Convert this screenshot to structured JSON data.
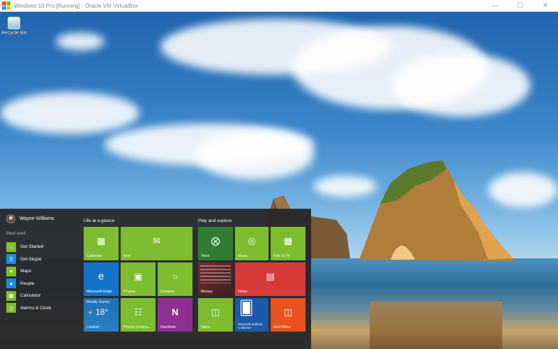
{
  "window": {
    "title": "Windows 10 Pro [Running] - Oracle VM VirtualBox",
    "icon": "virtualbox-icon",
    "controls": [
      "minimize-icon",
      "maximize-icon",
      "close-icon"
    ]
  },
  "desktop": {
    "icons": [
      {
        "label": "Recycle Bin",
        "icon": "recycle-bin-icon"
      }
    ]
  },
  "start_menu": {
    "user_name": "Wayne Williams",
    "most_used_header": "Most used",
    "apps": [
      {
        "label": "Get Started",
        "icon": "lightbulb-icon",
        "color": "#7dbd2f"
      },
      {
        "label": "Get Skype",
        "icon": "skype-icon",
        "color": "#1d8ae0"
      },
      {
        "label": "Maps",
        "icon": "person-icon",
        "color": "#7dbd2f"
      },
      {
        "label": "People",
        "icon": "people-icon",
        "color": "#1d8ae0"
      },
      {
        "label": "Calculator",
        "icon": "calculator-icon",
        "color": "#7dbd2f"
      },
      {
        "label": "Alarms & Clock",
        "icon": "alarm-icon",
        "color": "#7dbd2f"
      }
    ],
    "groups": {
      "life": "Life at a glance",
      "play": "Play and explore"
    },
    "tiles": {
      "calendar": "Calendar",
      "mail": "Mail",
      "edge": "Microsoft Edge",
      "photos": "Photos",
      "cortana": "Cortana",
      "weather_title": "Mostly Sunny",
      "weather_temp": "18°",
      "weather_city": "London",
      "phone": "Phone Compa...",
      "onenote": "OneNote",
      "xbox": "Xbox",
      "music": "Music",
      "films": "Film & TV",
      "money": "Money",
      "news": "News",
      "store": "Store",
      "solitaire": "Microsoft Solitaire Collection",
      "office": "Get Office"
    },
    "colors": {
      "green": "#7dbd2f",
      "blue": "#1473c9",
      "purple": "#8d2f93",
      "red": "#d83a3a",
      "orange": "#e9521d"
    }
  }
}
